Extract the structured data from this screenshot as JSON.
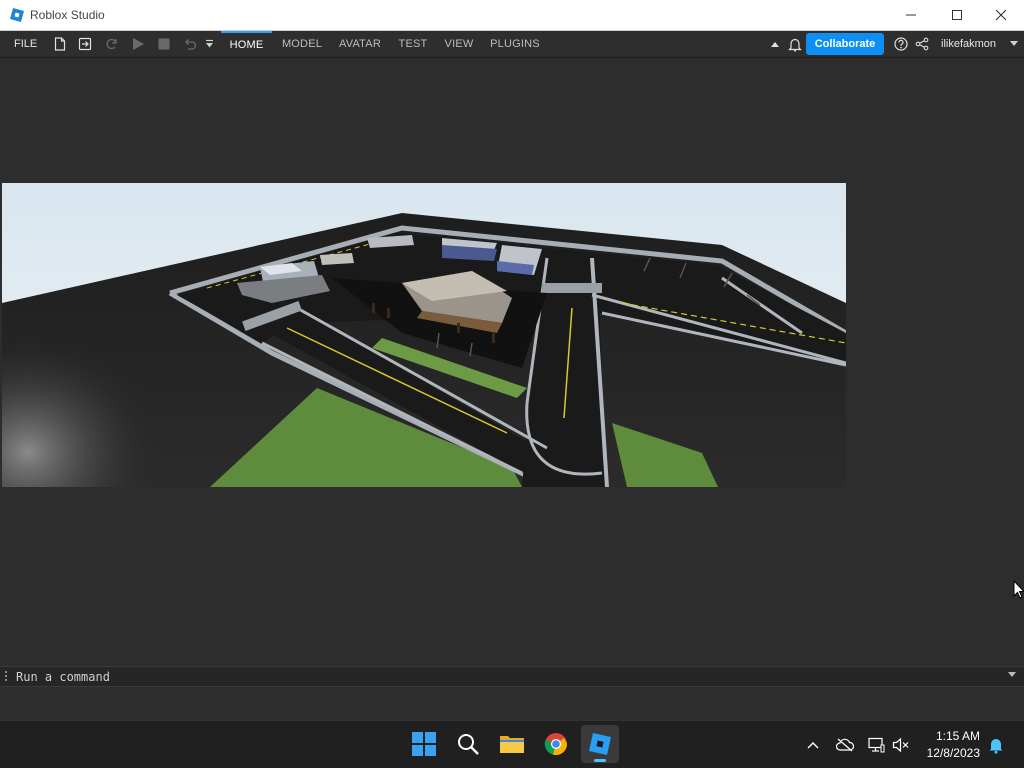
{
  "window": {
    "title": "Roblox Studio"
  },
  "menubar": {
    "file_label": "FILE",
    "tabs": [
      {
        "label": "HOME",
        "active": true
      },
      {
        "label": "MODEL",
        "active": false
      },
      {
        "label": "AVATAR",
        "active": false
      },
      {
        "label": "TEST",
        "active": false
      },
      {
        "label": "VIEW",
        "active": false
      },
      {
        "label": "PLUGINS",
        "active": false
      }
    ],
    "collaborate_label": "Collaborate",
    "username": "ilikefakmon"
  },
  "command_bar": {
    "placeholder": "Run a command"
  },
  "taskbar": {
    "apps": [
      "windows-start",
      "search",
      "file-explorer",
      "chrome",
      "roblox-studio"
    ],
    "clock_time": "1:15 AM",
    "clock_date": "12/8/2023"
  },
  "colors": {
    "accent": "#0c8ff4",
    "active_tab_underline": "#3c9bff",
    "workspace_bg": "#2d2d2d",
    "taskbar_bg": "#202020"
  }
}
